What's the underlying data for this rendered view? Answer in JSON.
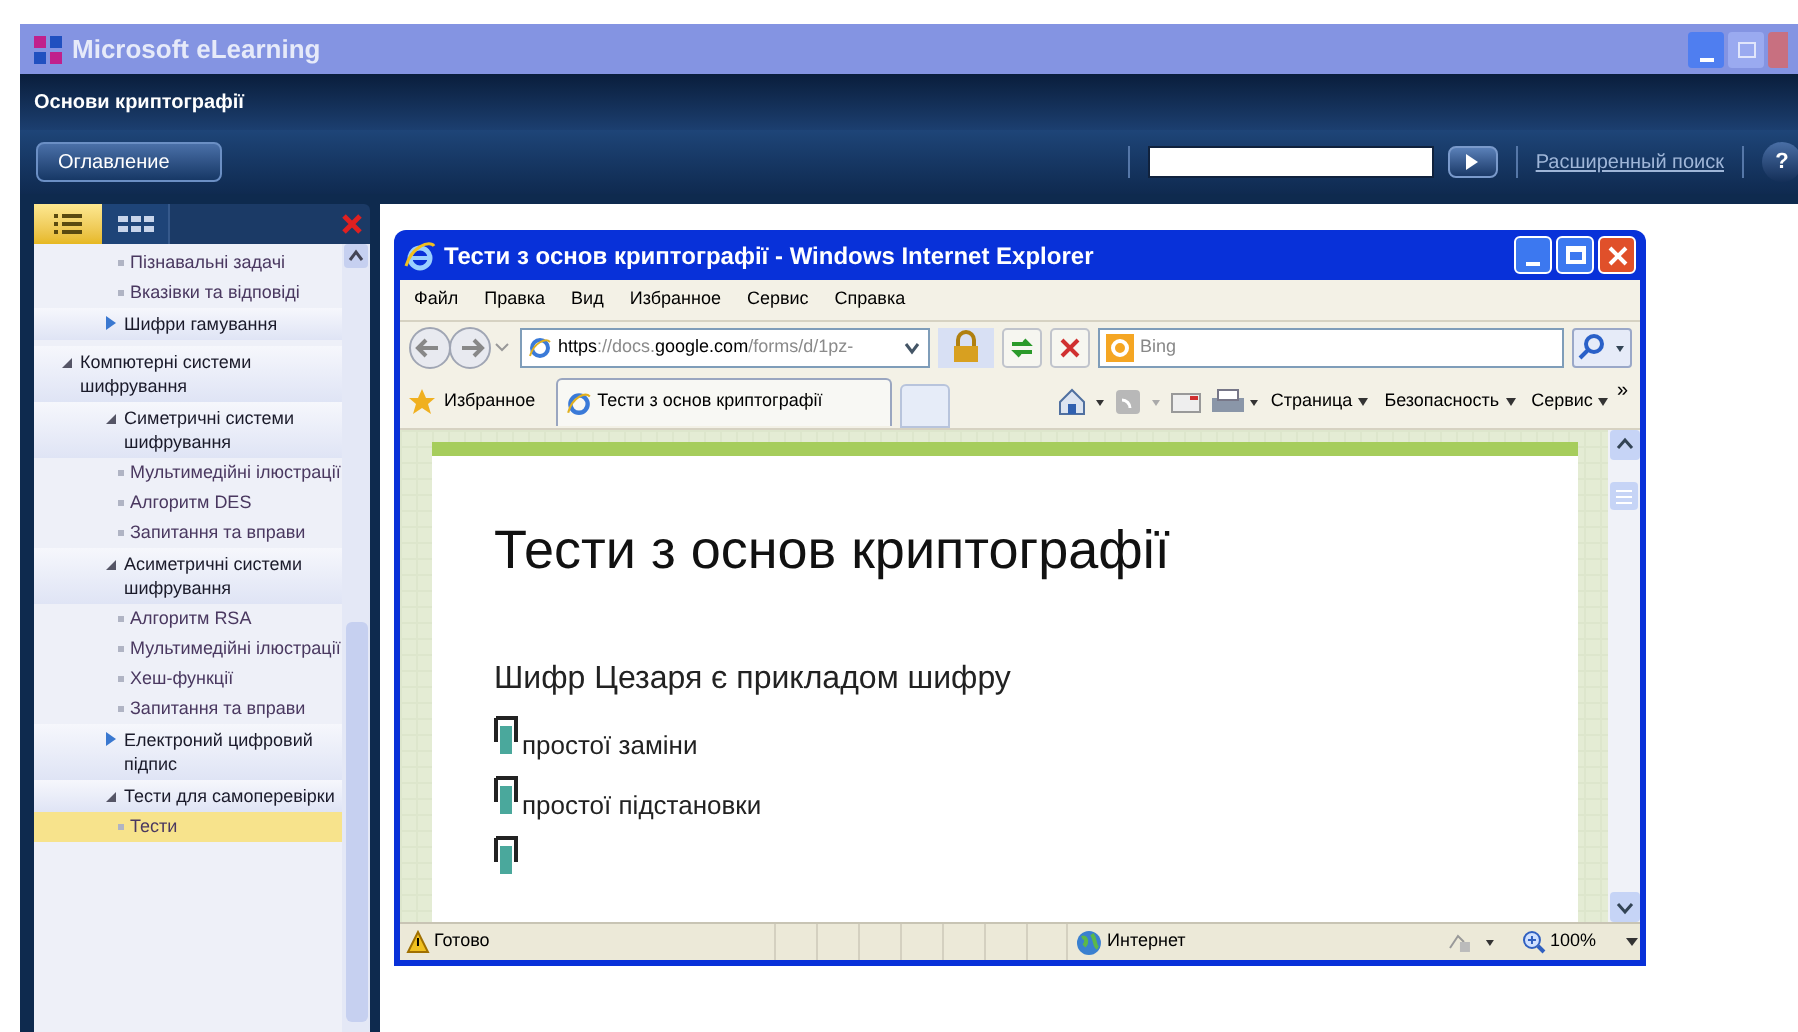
{
  "window": {
    "title": "Microsoft eLearning"
  },
  "course_title": "Основи криптографії",
  "toolbar": {
    "contents_button": "Оглавление",
    "advanced_search": "Расширенный поиск",
    "help": "?"
  },
  "sidebar": {
    "tabs": [
      {
        "kind": "list",
        "selected": true
      },
      {
        "kind": "grid",
        "selected": false
      }
    ],
    "items": [
      {
        "kind": "topic",
        "children": [
          {
            "kind": "topic",
            "children": [
              {
                "kind": "page",
                "label": "Пізнавальні задачі",
                "selected": false
              },
              {
                "kind": "page",
                "label": "Вказівки та відповіді",
                "selected": false
              }
            ]
          },
          {
            "kind": "topic",
            "label": "Шифри гамування",
            "expanded": false
          }
        ]
      },
      {
        "kind": "topic",
        "label": "Компютерні системи шифрування",
        "expanded": true,
        "children": [
          {
            "kind": "topic",
            "label": "Симетричні системи шифрування",
            "expanded": true,
            "children": [
              {
                "kind": "page",
                "label": "Мультимедійні ілюстрації",
                "selected": false
              },
              {
                "kind": "page",
                "label": "Алгоритм DES",
                "selected": false
              },
              {
                "kind": "page",
                "label": "Запитання та вправи",
                "selected": false
              }
            ]
          },
          {
            "kind": "topic",
            "label": "Асиметричні системи шифрування",
            "expanded": true,
            "children": [
              {
                "kind": "page",
                "label": "Алгоритм RSA",
                "selected": false
              },
              {
                "kind": "page",
                "label": "Мультимедійні ілюстрації",
                "selected": false
              },
              {
                "kind": "page",
                "label": "Хеш-функції",
                "selected": false
              },
              {
                "kind": "page",
                "label": "Запитання та вправи",
                "selected": false
              }
            ]
          },
          {
            "kind": "topic",
            "label": "Електроний цифровий підпис",
            "expanded": false
          },
          {
            "kind": "topic",
            "label": "Тести для самоперевірки",
            "expanded": true,
            "children": [
              {
                "kind": "page",
                "label": "Тести",
                "selected": true
              }
            ]
          }
        ]
      }
    ]
  },
  "browser": {
    "title": "Тести з основ криптографії - Windows Internet Explorer",
    "menu": [
      "Файл",
      "Правка",
      "Вид",
      "Избранное",
      "Сервис",
      "Справка"
    ],
    "address": [
      {
        "text": "https",
        "strong": true
      },
      {
        "text": "://docs.",
        "strong": false
      },
      {
        "text": "google.com",
        "strong": true
      },
      {
        "text": "/forms/d/1pz-",
        "strong": false
      }
    ],
    "search_placeholder": "Bing",
    "favorites": "Избранное",
    "tabs": [
      {
        "label": "Тести з основ криптографії",
        "selected": true
      }
    ],
    "commands": [
      "Страница",
      "Безопасность",
      "Сервис"
    ],
    "more": "»",
    "status": "Готово",
    "zone": "Интернет",
    "zoom": "100%"
  },
  "form": {
    "title": "Тести з основ криптографії",
    "question": "Шифр Цезаря є прикладом шифру",
    "options": [
      {
        "kind": "option",
        "label": "простої заміни"
      },
      {
        "kind": "option",
        "label": "простої підстановки"
      },
      {
        "kind": "option"
      }
    ]
  }
}
